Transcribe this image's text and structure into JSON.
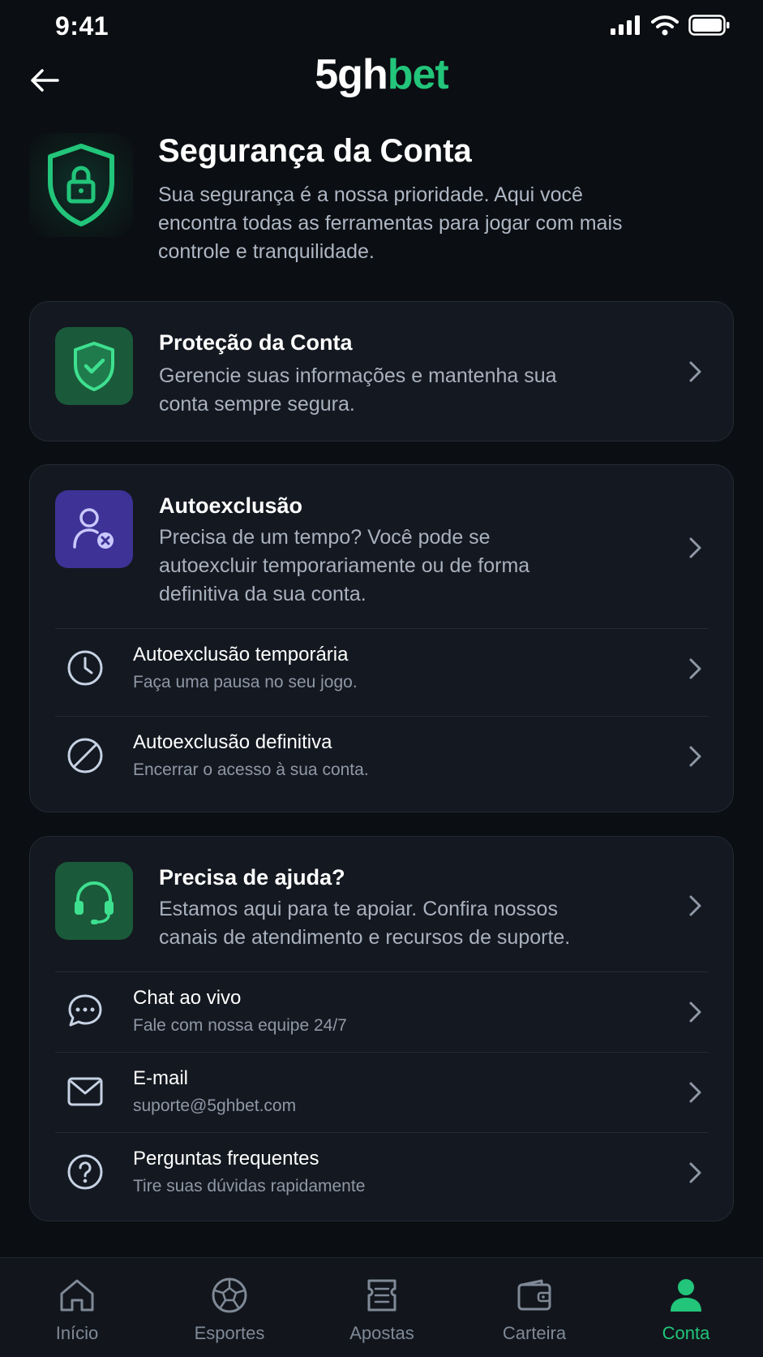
{
  "status_bar": {
    "time": "9:41"
  },
  "header": {
    "logo_part1": "5gh",
    "logo_part2": "bet"
  },
  "hero": {
    "title": "Segurança da Conta",
    "description": "Sua segurança é a nossa prioridade. Aqui você encontra todas as ferramentas para jogar com mais controle e tranquilidade."
  },
  "protection": {
    "title": "Proteção da Conta",
    "description": "Gerencie suas informações e mantenha sua conta sempre segura."
  },
  "self_exclusion": {
    "title": "Autoexclusão",
    "description": "Precisa de um tempo? Você pode se autoexcluir temporariamente ou de forma definitiva da sua conta.",
    "items": [
      {
        "title": "Autoexclusão temporária",
        "subtitle": "Faça uma pausa no seu jogo.",
        "icon": "clock-icon"
      },
      {
        "title": "Autoexclusão definitiva",
        "subtitle": "Encerrar o acesso à sua conta.",
        "icon": "block-icon"
      }
    ]
  },
  "help": {
    "title": "Precisa de ajuda?",
    "description": "Estamos aqui para te apoiar. Confira nossos canais de atendimento e recursos de suporte.",
    "items": [
      {
        "title": "Chat ao vivo",
        "subtitle": "Fale com nossa equipe 24/7",
        "icon": "chat-icon"
      },
      {
        "title": "E-mail",
        "subtitle": "suporte@5ghbet.com",
        "icon": "mail-icon"
      },
      {
        "title": "Perguntas frequentes",
        "subtitle": "Tire suas dúvidas rapidamente",
        "icon": "question-icon"
      }
    ]
  },
  "bottom_nav": {
    "items": [
      {
        "label": "Início",
        "icon": "home-icon"
      },
      {
        "label": "Esportes",
        "icon": "soccer-ball-icon"
      },
      {
        "label": "Apostas",
        "icon": "ticket-icon"
      },
      {
        "label": "Carteira",
        "icon": "wallet-icon"
      },
      {
        "label": "Conta",
        "icon": "user-icon"
      }
    ],
    "active": "Conta"
  },
  "colors": {
    "background": "#0b0e12",
    "card": "#141820",
    "accent": "#22c57a",
    "purple": "#3e3296"
  }
}
